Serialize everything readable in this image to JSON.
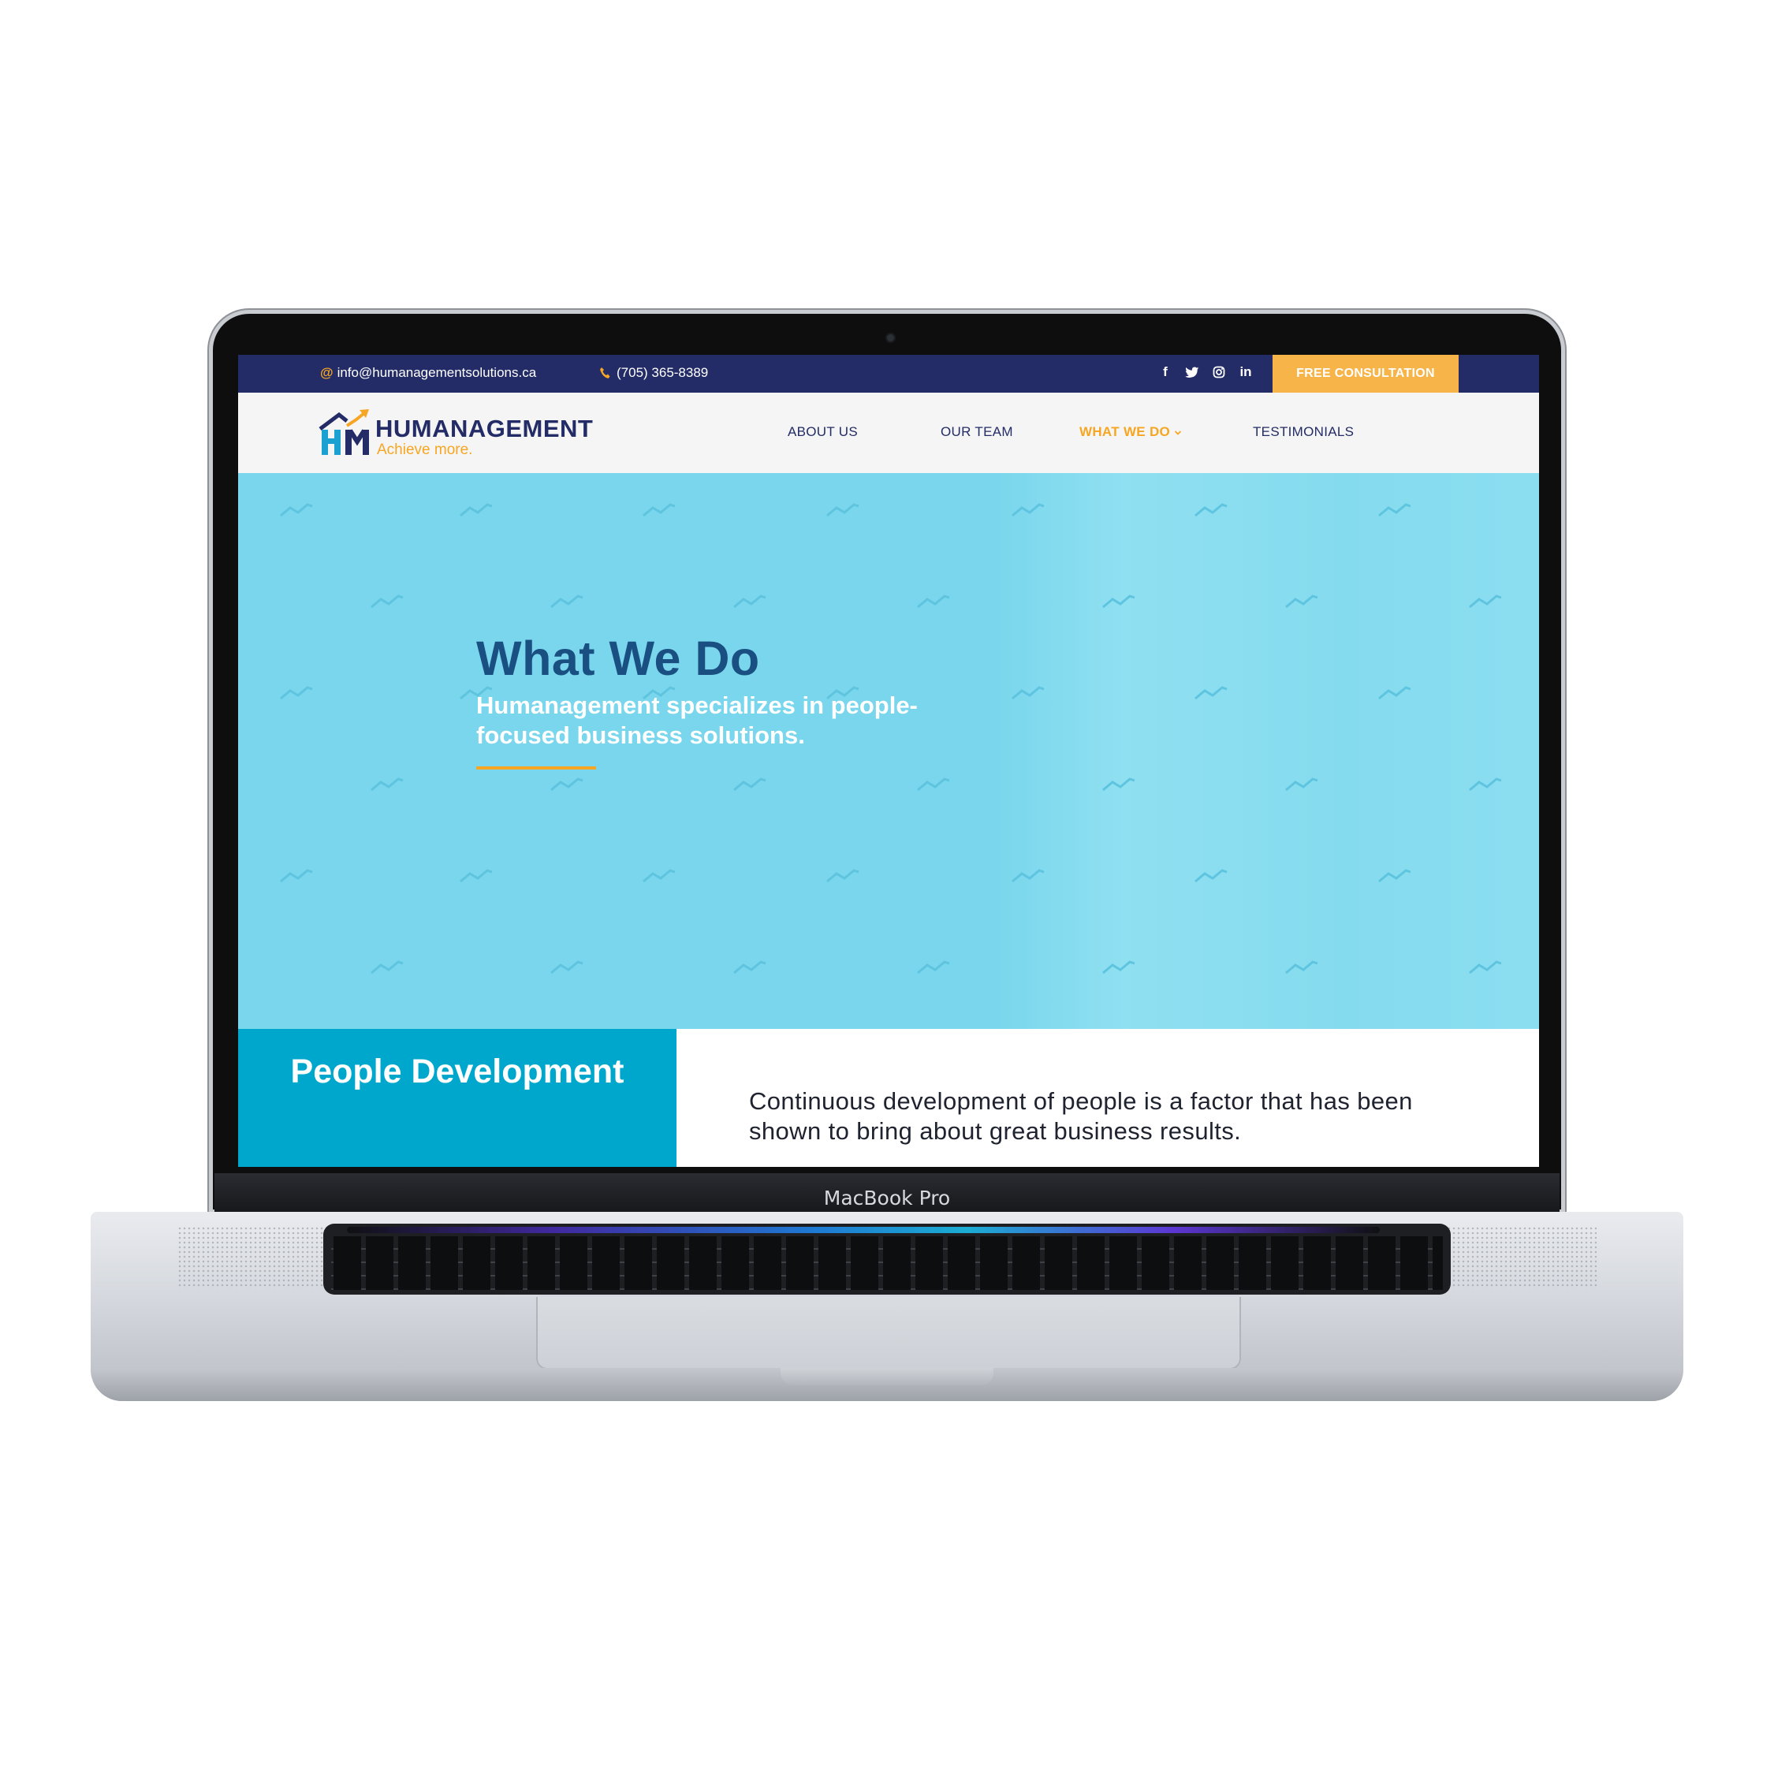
{
  "device": {
    "model_label": "MacBook Pro"
  },
  "topbar": {
    "email_icon": "@",
    "email": "info@humanagementsolutions.ca",
    "phone_icon": "phone-icon",
    "phone": "(705) 365-8389",
    "socials": [
      {
        "name": "facebook-icon",
        "glyph": "f"
      },
      {
        "name": "twitter-icon",
        "glyph": ""
      },
      {
        "name": "instagram-icon",
        "glyph": ""
      },
      {
        "name": "linkedin-icon",
        "glyph": "in"
      }
    ],
    "cta_label": "FREE CONSULTATION",
    "background": "#232c66",
    "cta_color": "#f7b448"
  },
  "logo": {
    "name": "HUMANAGEMENT",
    "tagline": "Achieve more."
  },
  "nav": {
    "items": [
      {
        "label": "ABOUT US",
        "active": false
      },
      {
        "label": "OUR TEAM",
        "active": false
      },
      {
        "label": "WHAT WE DO",
        "active": true,
        "dropdown": true
      },
      {
        "label": "TESTIMONIALS",
        "active": false
      }
    ],
    "active_color": "#f6a623"
  },
  "hero": {
    "title": "What We Do",
    "subtitle": "Humanagement specializes in people-focused business solutions.",
    "background": "#79d6ec",
    "title_color": "#1a4f82"
  },
  "section": {
    "title": "People Development",
    "text": "Continuous development of people is a factor that has been shown to bring about great business results.",
    "panel_color": "#00a7cd"
  }
}
